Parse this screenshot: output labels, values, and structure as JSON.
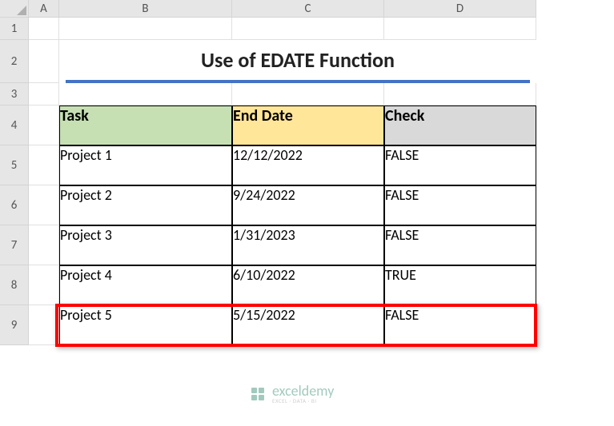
{
  "columns": [
    "A",
    "B",
    "C",
    "D"
  ],
  "rows": [
    "1",
    "2",
    "3",
    "4",
    "5",
    "6",
    "7",
    "8",
    "9"
  ],
  "title": "Use of EDATE Function",
  "headers": {
    "task": "Task",
    "endDate": "End Date",
    "check": "Check"
  },
  "data": [
    {
      "task": "Project 1",
      "endDate": "12/12/2022",
      "check": "FALSE"
    },
    {
      "task": "Project 2",
      "endDate": "9/24/2022",
      "check": "FALSE"
    },
    {
      "task": "Project 3",
      "endDate": "1/31/2023",
      "check": "FALSE"
    },
    {
      "task": "Project 4",
      "endDate": "6/10/2022",
      "check": "TRUE"
    },
    {
      "task": "Project 5",
      "endDate": "5/15/2022",
      "check": "FALSE"
    }
  ],
  "highlightRowIndex": 3,
  "watermark": {
    "name": "exceldemy",
    "tag": "EXCEL · DATA · BI"
  },
  "chart_data": {
    "type": "table",
    "title": "Use of EDATE Function",
    "columns": [
      "Task",
      "End Date",
      "Check"
    ],
    "rows": [
      [
        "Project 1",
        "12/12/2022",
        "FALSE"
      ],
      [
        "Project 2",
        "9/24/2022",
        "FALSE"
      ],
      [
        "Project 3",
        "1/31/2023",
        "FALSE"
      ],
      [
        "Project 4",
        "6/10/2022",
        "TRUE"
      ],
      [
        "Project 5",
        "5/15/2022",
        "FALSE"
      ]
    ]
  }
}
